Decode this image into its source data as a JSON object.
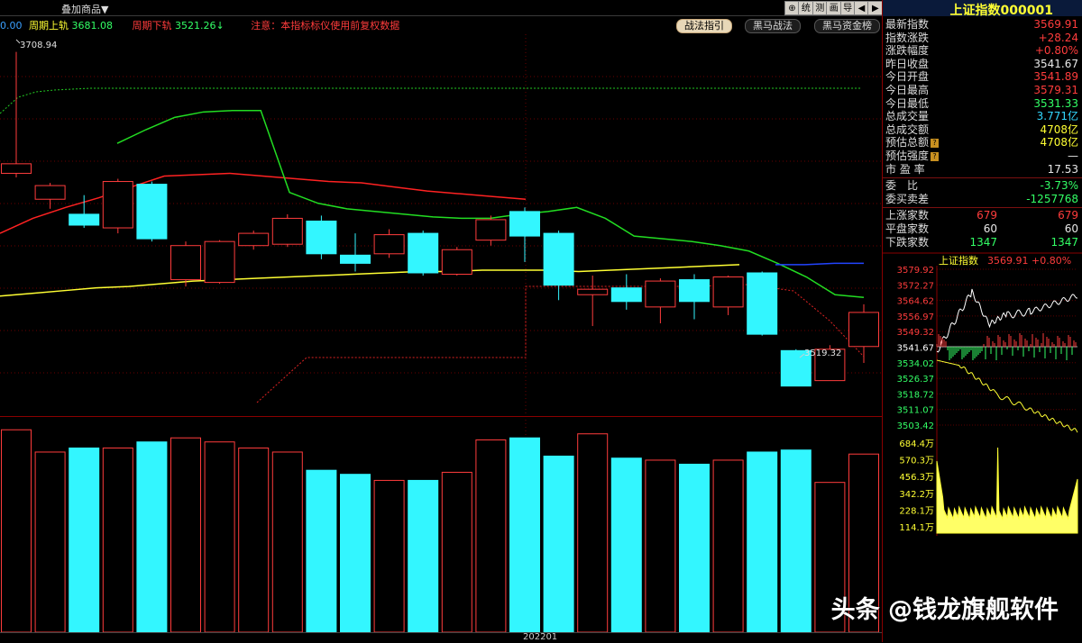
{
  "toolbar": {
    "left_code": "0.00",
    "overlay_menu": "叠加商品▼",
    "upper_rail_label": "周期上轨",
    "upper_rail_value": "3681.08",
    "lower_rail_label": "周期下轨",
    "lower_rail_value": "3521.26↓",
    "notice": "注意：本指标标仪使用前复权数据",
    "tabs": [
      "战法指引",
      "黑马战法",
      "黑马资金榜"
    ],
    "icons": [
      "⊕",
      "统",
      "测",
      "画",
      "导",
      "◀",
      "▶"
    ],
    "icon_names": [
      "move-icon",
      "stats-icon",
      "test-icon",
      "draw-icon",
      "export-icon",
      "prev-icon",
      "next-icon"
    ]
  },
  "annotations": {
    "high_label": "3708.94",
    "low_label": "3519.32",
    "date_label": "202201"
  },
  "quote": {
    "title": "上证指数000001",
    "rows": [
      {
        "label": "最新指数",
        "value": "3569.91",
        "color": "red"
      },
      {
        "label": "指数涨跌",
        "value": "+28.24",
        "color": "red"
      },
      {
        "label": "涨跌幅度",
        "value": "+0.80%",
        "color": "red"
      },
      {
        "label": "昨日收盘",
        "value": "3541.67",
        "color": "white"
      },
      {
        "label": "今日开盘",
        "value": "3541.89",
        "color": "red"
      },
      {
        "label": "今日最高",
        "value": "3579.31",
        "color": "red"
      },
      {
        "label": "今日最低",
        "value": "3531.33",
        "color": "green"
      },
      {
        "label": "总成交量",
        "value": "3.771亿",
        "color": "cyan"
      },
      {
        "label": "总成交额",
        "value": "4708亿",
        "color": "yellow"
      },
      {
        "label": "预估总额",
        "value": "4708亿",
        "color": "yellow",
        "badge": "?"
      },
      {
        "label": "预估强度",
        "value": "—",
        "color": "white",
        "badge": "?"
      },
      {
        "label": "市 盈 率",
        "value": "17.53",
        "color": "white"
      }
    ],
    "rows2": [
      {
        "label": "委　比",
        "value": "-3.73%",
        "color": "green"
      },
      {
        "label": "委买卖差",
        "value": "-1257768",
        "color": "green"
      }
    ],
    "breadth": [
      {
        "label": "上涨家数",
        "v1": "679",
        "v2": "679",
        "color": "red"
      },
      {
        "label": "平盘家数",
        "v1": "60",
        "v2": "60",
        "color": "white"
      },
      {
        "label": "下跌家数",
        "v1": "1347",
        "v2": "1347",
        "color": "green"
      }
    ]
  },
  "minichart": {
    "title": "上证指数",
    "price": "3569.91",
    "change": "+0.80%",
    "price_labels": [
      "3579.92",
      "3572.27",
      "3564.62",
      "3556.97",
      "3549.32",
      "3541.67",
      "3534.02",
      "3526.37",
      "3518.72",
      "3511.07",
      "3503.42"
    ],
    "vol_labels": [
      "684.4万",
      "570.3万",
      "456.3万",
      "342.2万",
      "228.1万",
      "114.1万"
    ]
  },
  "chart_data": {
    "type": "candlestick",
    "candles": [
      {
        "o": 3618,
        "c": 3625,
        "h": 3707,
        "l": 3615
      },
      {
        "o": 3599,
        "c": 3609,
        "h": 3611,
        "l": 3592
      },
      {
        "o": 3588,
        "c": 3580,
        "h": 3602,
        "l": 3578
      },
      {
        "o": 3578,
        "c": 3612,
        "h": 3614,
        "l": 3574
      },
      {
        "o": 3610,
        "c": 3570,
        "h": 3612,
        "l": 3568
      },
      {
        "o": 3540,
        "c": 3565,
        "h": 3568,
        "l": 3535
      },
      {
        "o": 3538,
        "c": 3568,
        "h": 3569,
        "l": 3537
      },
      {
        "o": 3565,
        "c": 3574,
        "h": 3576,
        "l": 3562
      },
      {
        "o": 3566,
        "c": 3585,
        "h": 3588,
        "l": 3564
      },
      {
        "o": 3583,
        "c": 3559,
        "h": 3587,
        "l": 3555
      },
      {
        "o": 3558,
        "c": 3552,
        "h": 3574,
        "l": 3546
      },
      {
        "o": 3559,
        "c": 3573,
        "h": 3577,
        "l": 3556
      },
      {
        "o": 3574,
        "c": 3545,
        "h": 3576,
        "l": 3543
      },
      {
        "o": 3544,
        "c": 3562,
        "h": 3564,
        "l": 3543
      },
      {
        "o": 3569,
        "c": 3584,
        "h": 3587,
        "l": 3565
      },
      {
        "o": 3590,
        "c": 3572,
        "h": 3593,
        "l": 3553
      },
      {
        "o": 3574,
        "c": 3536,
        "h": 3576,
        "l": 3525
      },
      {
        "o": 3529,
        "c": 3533,
        "h": 3543,
        "l": 3506
      },
      {
        "o": 3534,
        "c": 3524,
        "h": 3544,
        "l": 3518
      },
      {
        "o": 3520,
        "c": 3539,
        "h": 3541,
        "l": 3508
      },
      {
        "o": 3540,
        "c": 3524,
        "h": 3544,
        "l": 3511
      },
      {
        "o": 3520,
        "c": 3542,
        "h": 3543,
        "l": 3514
      },
      {
        "o": 3545,
        "c": 3500,
        "h": 3546,
        "l": 3499
      },
      {
        "o": 3488,
        "c": 3462,
        "h": 3489,
        "l": 3462
      },
      {
        "o": 3466,
        "c": 3489,
        "h": 3492,
        "l": 3466
      },
      {
        "o": 3491,
        "c": 3516,
        "h": 3522,
        "l": 3479
      }
    ],
    "volumes": [
      100,
      89,
      91,
      91,
      94,
      96,
      94,
      91,
      89,
      80,
      78,
      75,
      75,
      79,
      95,
      96,
      87,
      98,
      86,
      85,
      83,
      85,
      89,
      90,
      74,
      88
    ],
    "price_range": [
      3440,
      3720
    ],
    "ma_green": [
      3640,
      3650,
      3659,
      3663,
      3664,
      3664,
      3604,
      3596,
      3592,
      3590,
      3588,
      3586,
      3585,
      3585,
      3588,
      3590,
      3593,
      3585,
      3572,
      3570,
      3568,
      3565,
      3561,
      3552,
      3542,
      3529,
      3527
    ],
    "ma_red": [
      3574,
      3585,
      3593,
      3600,
      3608,
      3616,
      3617,
      3618,
      3616,
      3614,
      3612,
      3611,
      3608,
      3605,
      3603,
      3601,
      3599
    ],
    "ma_yellow": [
      3528,
      3530,
      3532,
      3534,
      3535,
      3537,
      3539,
      3540,
      3541,
      3542,
      3543,
      3544,
      3545,
      3546,
      3546,
      3547,
      3547,
      3547,
      3546,
      3547,
      3548,
      3549,
      3550,
      3551
    ],
    "ma_blue": [
      3551,
      3551,
      3552,
      3552
    ],
    "volume_range": [
      0,
      105
    ]
  },
  "colors": {
    "up": "#ff3c3c",
    "down": "#33f6ff",
    "grid": "#6a0000",
    "text_label": "#e0e0e0"
  }
}
